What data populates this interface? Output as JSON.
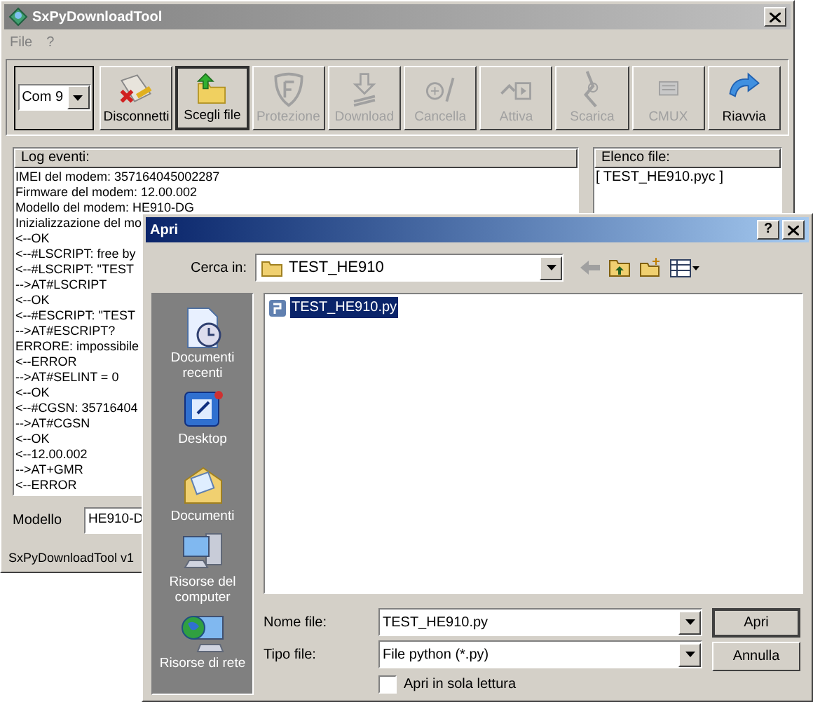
{
  "window": {
    "title": "SxPyDownloadTool"
  },
  "menu": [
    "File",
    "?"
  ],
  "toolbar": {
    "port": {
      "value": "Com 9"
    },
    "buttons": [
      {
        "label": "Disconnetti",
        "disabled": false,
        "focused": false
      },
      {
        "label": "Scegli file",
        "disabled": false,
        "focused": true
      },
      {
        "label": "Protezione",
        "disabled": true,
        "focused": false
      },
      {
        "label": "Download",
        "disabled": true,
        "focused": false
      },
      {
        "label": "Cancella",
        "disabled": true,
        "focused": false
      },
      {
        "label": "Attiva",
        "disabled": true,
        "focused": false
      },
      {
        "label": "Scarica",
        "disabled": true,
        "focused": false
      },
      {
        "label": "CMUX",
        "disabled": true,
        "focused": false
      },
      {
        "label": "Riavvia",
        "disabled": false,
        "focused": false
      }
    ]
  },
  "log": {
    "title": "Log eventi:",
    "lines": [
      "IMEI del modem: 357164045002287",
      "Firmware del modem: 12.00.002",
      "Modello del modem: HE910-DG",
      "Inizializzazione del mo",
      "<--OK",
      "<--#LSCRIPT: free by",
      "<--#LSCRIPT: \"TEST",
      "-->AT#LSCRIPT",
      "<--OK",
      "<--#ESCRIPT: \"TEST",
      "-->AT#ESCRIPT?",
      "ERRORE: impossibile",
      "<--ERROR",
      "-->AT#SELINT = 0",
      "<--OK",
      "<--#CGSN: 35716404",
      "-->AT#CGSN",
      "<--OK",
      "<--12.00.002",
      "-->AT+GMR",
      "<--ERROR"
    ]
  },
  "file_list": {
    "title": "Elenco file:",
    "items": [
      "[ TEST_HE910.pyc ]"
    ]
  },
  "model": {
    "label": "Modello",
    "value": "HE910-D"
  },
  "status_bar": "SxPyDownloadTool v1",
  "dialog": {
    "title": "Apri",
    "help_button": "?",
    "look_in": {
      "label": "Cerca in:",
      "value": "TEST_HE910"
    },
    "places": [
      "Documenti recenti",
      "Desktop",
      "Documenti",
      "Risorse del computer",
      "Risorse di rete"
    ],
    "files": [
      {
        "name": "TEST_HE910.py",
        "selected": true
      }
    ],
    "file_name": {
      "label": "Nome file:",
      "value": "TEST_HE910.py"
    },
    "file_type": {
      "label": "Tipo file:",
      "value": "File python (*.py)"
    },
    "read_only": {
      "label": "Apri in sola lettura",
      "checked": false
    },
    "buttons": [
      "Apri",
      "Annulla"
    ]
  }
}
